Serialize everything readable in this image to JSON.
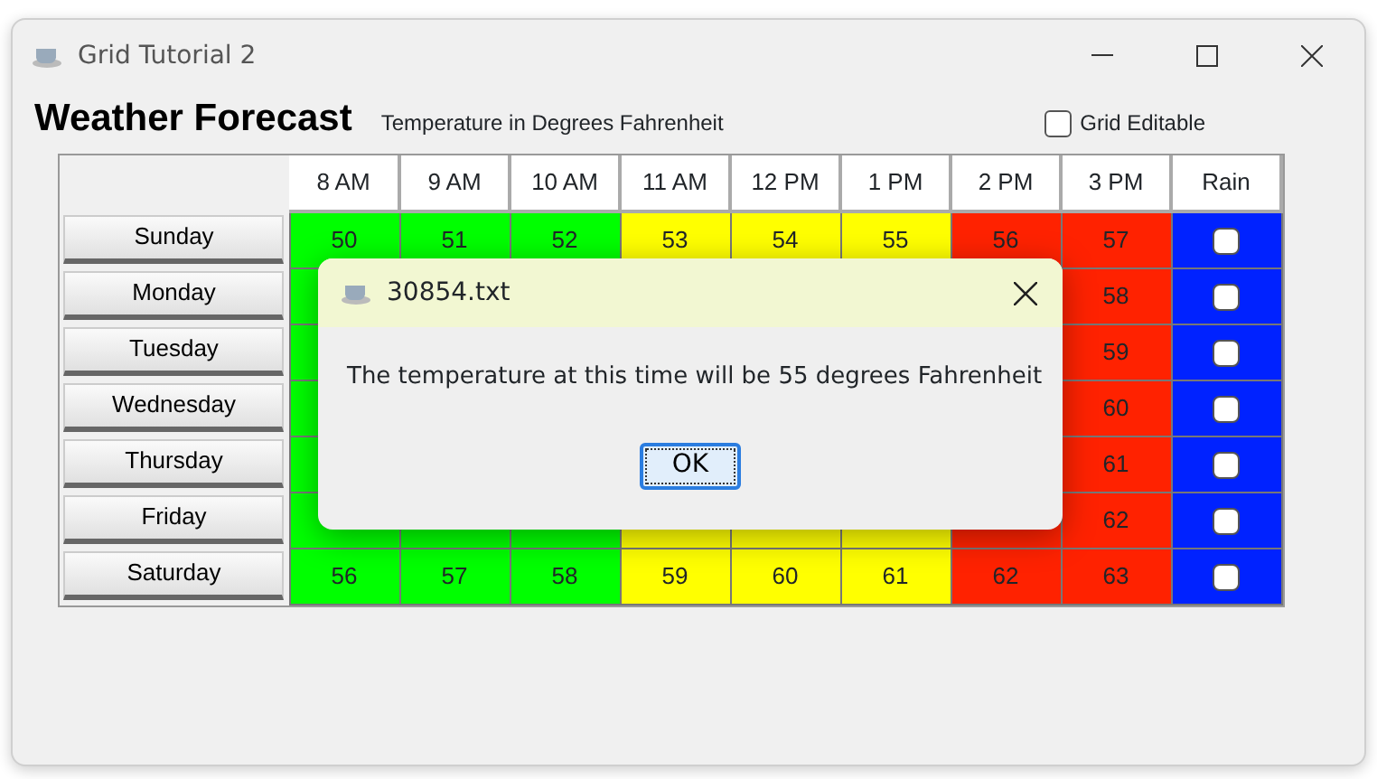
{
  "window": {
    "title": "Grid Tutorial 2"
  },
  "heading": "Weather Forecast",
  "subtitle": "Temperature in Degrees Fahrenheit",
  "grid_editable": {
    "label": "Grid Editable",
    "checked": false
  },
  "grid": {
    "columns": [
      {
        "label": "8 AM",
        "color": "#00ff00"
      },
      {
        "label": "9 AM",
        "color": "#00ff00"
      },
      {
        "label": "10 AM",
        "color": "#00ff00"
      },
      {
        "label": "11 AM",
        "color": "#ffff00"
      },
      {
        "label": "12 PM",
        "color": "#ffff00"
      },
      {
        "label": "1 PM",
        "color": "#ffff00"
      },
      {
        "label": "2 PM",
        "color": "#ff2200"
      },
      {
        "label": "3 PM",
        "color": "#ff2200"
      },
      {
        "label": "Rain",
        "color": "#0022ff"
      }
    ],
    "rows": [
      {
        "day": "Sunday",
        "temps": [
          "50",
          "51",
          "52",
          "53",
          "54",
          "55",
          "56",
          "57"
        ],
        "rain": false
      },
      {
        "day": "Monday",
        "temps": [
          "58"
        ],
        "rain": false
      },
      {
        "day": "Tuesday",
        "temps": [
          "59"
        ],
        "rain": false
      },
      {
        "day": "Wednesday",
        "temps": [
          "60"
        ],
        "rain": false
      },
      {
        "day": "Thursday",
        "temps": [
          "61"
        ],
        "rain": false
      },
      {
        "day": "Friday",
        "temps": [
          "62"
        ],
        "rain": false
      },
      {
        "day": "Saturday",
        "temps": [
          "56",
          "57",
          "58",
          "59",
          "60",
          "61",
          "62",
          "63"
        ],
        "rain": false
      }
    ]
  },
  "dialog": {
    "title": "30854.txt",
    "message": "The temperature at this time will be 55 degrees Fahrenheit",
    "button": "OK"
  }
}
